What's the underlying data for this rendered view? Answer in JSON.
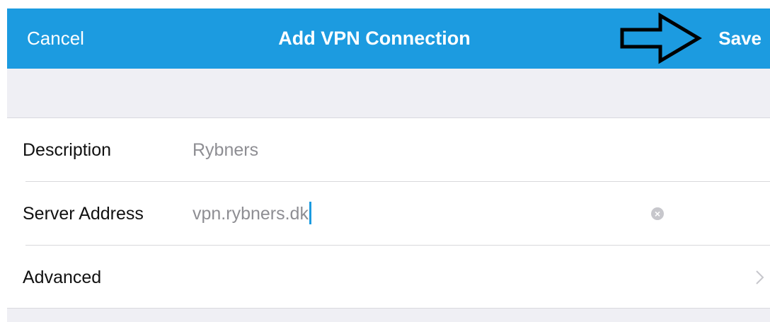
{
  "navbar": {
    "cancel_label": "Cancel",
    "title": "Add VPN Connection",
    "save_label": "Save",
    "accent_color": "#1c9be0"
  },
  "form": {
    "rows": [
      {
        "label": "Description",
        "value": "Rybners"
      },
      {
        "label": "Server Address",
        "value": "vpn.rybners.dk",
        "icon": "clear-icon"
      },
      {
        "label": "Advanced",
        "icon": "chevron-right-icon"
      }
    ]
  }
}
